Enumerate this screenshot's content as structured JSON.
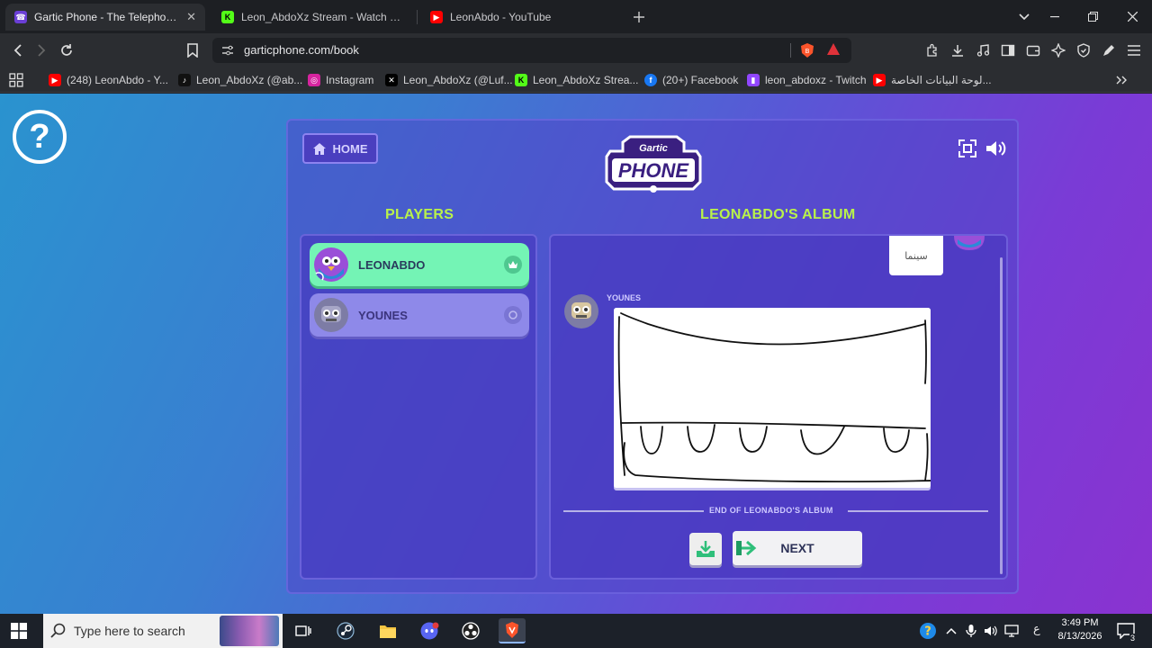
{
  "browser": {
    "tabs": [
      {
        "title": "Gartic Phone - The Telephone Ga",
        "active": true,
        "favicon_color": "#6b3fd6"
      },
      {
        "title": "Leon_AbdoXz Stream - Watch Live or",
        "active": false,
        "favicon_color": "#53fc18"
      },
      {
        "title": "LeonAbdo - YouTube",
        "active": false,
        "favicon_color": "#ff0000"
      }
    ],
    "url": "garticphone.com/book",
    "bookmarks": [
      {
        "label": "(248) LeonAbdo - Y...",
        "color": "#ff0000"
      },
      {
        "label": "Leon_AbdoXz (@ab...",
        "color": "#111111"
      },
      {
        "label": "Instagram",
        "color": "#d6249f"
      },
      {
        "label": "Leon_AbdoXz (@Luf...",
        "color": "#000000"
      },
      {
        "label": "Leon_AbdoXz Strea...",
        "color": "#53fc18"
      },
      {
        "label": "(20+) Facebook",
        "color": "#1877f2"
      },
      {
        "label": "leon_abdoxz - Twitch",
        "color": "#9146ff"
      },
      {
        "label": "لوحة البيانات الخاصة...",
        "color": "#ff0000"
      }
    ]
  },
  "game": {
    "home_label": "HOME",
    "players_title": "PLAYERS",
    "album_title": "LEONABDO'S ALBUM",
    "players": [
      {
        "name": "LEONABDO",
        "host": true
      },
      {
        "name": "YOUNES",
        "host": false
      }
    ],
    "bubble_text": "سينما",
    "drawing_author": "YOUNES",
    "end_label": "END OF LEONABDO'S ALBUM",
    "next_label": "NEXT"
  },
  "taskbar": {
    "search_placeholder": "Type here to search",
    "time": "3:49 PM",
    "date": "8/13/2026",
    "lang": "ع",
    "notifications": "3"
  }
}
